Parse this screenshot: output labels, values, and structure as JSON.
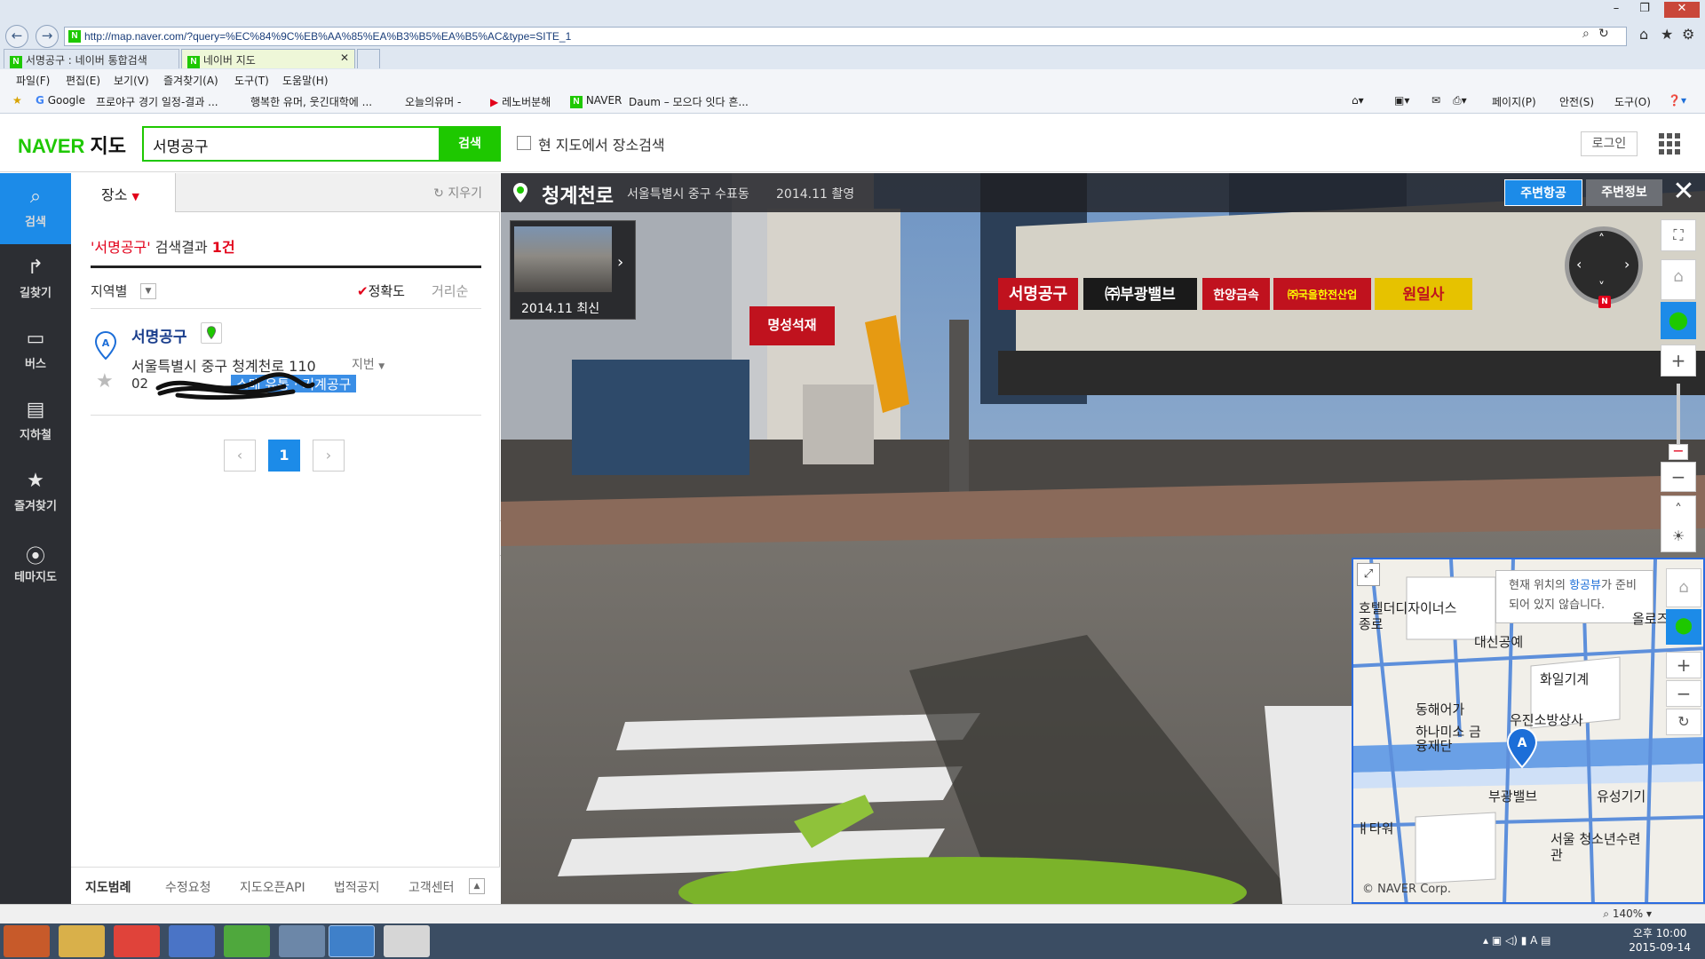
{
  "browser": {
    "url": "http://map.naver.com/?query=%EC%84%9C%EB%AA%85%EA%B3%B5%EA%B5%AC&type=SITE_1",
    "tabs": [
      {
        "label": "서명공구 : 네이버 통합검색"
      },
      {
        "label": "네이버 지도"
      }
    ],
    "menu": [
      "파일(F)",
      "편집(E)",
      "보기(V)",
      "즐겨찾기(A)",
      "도구(T)",
      "도움말(H)"
    ],
    "favorites": [
      "Google",
      "프로야구 경기 일정-결과 ...",
      "행복한 유머, 웃긴대학에 ...",
      "오늘의유머 -",
      "레노버분해",
      "NAVER",
      "Daum – 모으다 잇다 흔..."
    ],
    "command_bar": [
      "페이지(P)",
      "안전(S)",
      "도구(O)"
    ]
  },
  "header": {
    "logo_brand": "NAVER",
    "logo_service": "지도",
    "search_value": "서명공구",
    "search_button": "검색",
    "checkbox_label": "현 지도에서 장소검색",
    "login": "로그인"
  },
  "leftnav": [
    {
      "label": "검색",
      "icon": "search-icon"
    },
    {
      "label": "길찾기",
      "icon": "directions-icon"
    },
    {
      "label": "버스",
      "icon": "bus-icon"
    },
    {
      "label": "지하철",
      "icon": "subway-icon"
    },
    {
      "label": "즐겨찾기",
      "icon": "star-icon"
    },
    {
      "label": "테마지도",
      "icon": "theme-pin-icon"
    }
  ],
  "panel": {
    "tab": "장소",
    "clear": "지우기",
    "result_query": "'서명공구'",
    "result_mid": "검색결과",
    "result_count": "1건",
    "region_label": "지역별",
    "sort_accuracy": "정확도",
    "sort_distance": "거리순",
    "result": {
      "marker": "A",
      "name": "서명공구",
      "address": "서울특별시 중구 청계천로 110",
      "jibun": "지번",
      "phone": "02",
      "category": "소매 유통 · 기계공구"
    },
    "pagination": {
      "prev": "‹",
      "current": "1",
      "next": "›"
    },
    "footer": [
      "지도범례",
      "수정요청",
      "지도오픈API",
      "법적공지",
      "고객센터"
    ]
  },
  "panorama": {
    "title": "청계천로",
    "address": "서울특별시 중구 수표동",
    "date": "2014.11 촬영",
    "btn_aerial": "주변항공",
    "btn_info": "주변정보",
    "thumb_date": "2014.11 최신",
    "compass_n": "N",
    "signs": [
      "서명공구",
      "㈜부광밸브",
      "한양금속",
      "㈜국을한전산업",
      "원일사",
      "명성석재"
    ]
  },
  "minimap": {
    "note_pre": "현재 위치의 ",
    "note_link": "항공뷰",
    "note_post": "가 준비되어 있지 않습니다.",
    "labels": [
      "호텔더디자이너스 종로",
      "대신공예",
      "화일기계",
      "동해어가",
      "우진소방상사",
      "하나미소 금융재단",
      "부광밸브",
      "유성기기",
      "서울 청소년수련관",
      "올로즈스",
      "ㅒ타워"
    ],
    "copyright": "© NAVER Corp."
  },
  "statusbar": {
    "zoom": "140%"
  },
  "taskbar": {
    "time": "오후 10:00",
    "date": "2015-09-14"
  },
  "colors": {
    "naver_green": "#1ec800",
    "accent_blue": "#1c8be8",
    "highlight_red": "#e2001a"
  }
}
